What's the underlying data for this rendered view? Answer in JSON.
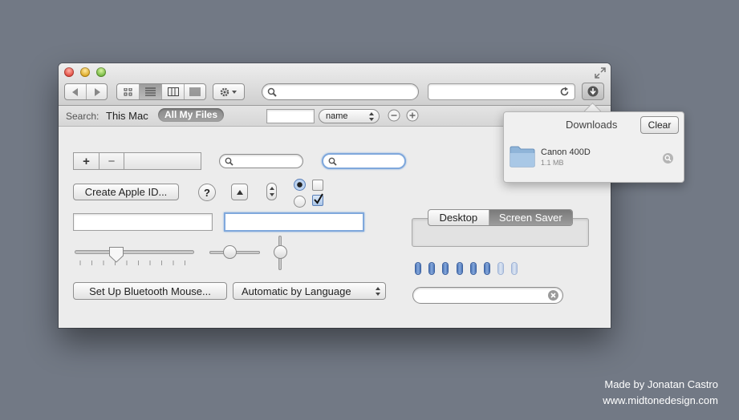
{
  "toolbar": {
    "back_icon": "back-arrow-icon",
    "forward_icon": "forward-arrow-icon",
    "view_modes": [
      "icon-view",
      "list-view",
      "column-view",
      "coverflow-view"
    ],
    "action_icon": "gear-icon"
  },
  "search_bar": {
    "label": "Search:",
    "scope_this_mac": "This Mac",
    "scope_all_files": "All My Files",
    "sort_value": "name"
  },
  "downloads": {
    "title": "Downloads",
    "clear_label": "Clear",
    "item_name": "Canon 400D",
    "item_size": "1.1 MB"
  },
  "controls": {
    "add_label": "+",
    "remove_label": "−",
    "create_apple_id_label": "Create Apple ID...",
    "help_label": "?",
    "bluetooth_label": "Set Up Bluetooth Mouse...",
    "language_popup_value": "Automatic by Language",
    "tab_desktop": "Desktop",
    "tab_screen_saver": "Screen Saver"
  },
  "level_indicator": {
    "filled": 6,
    "total": 8
  },
  "credit": {
    "line1": "Made by Jonatan Castro",
    "line2": "www.midtonedesign.com"
  },
  "colors": {
    "background": "#727985",
    "accent": "#5b84c4",
    "selected_scope": "#8e8e8e"
  }
}
